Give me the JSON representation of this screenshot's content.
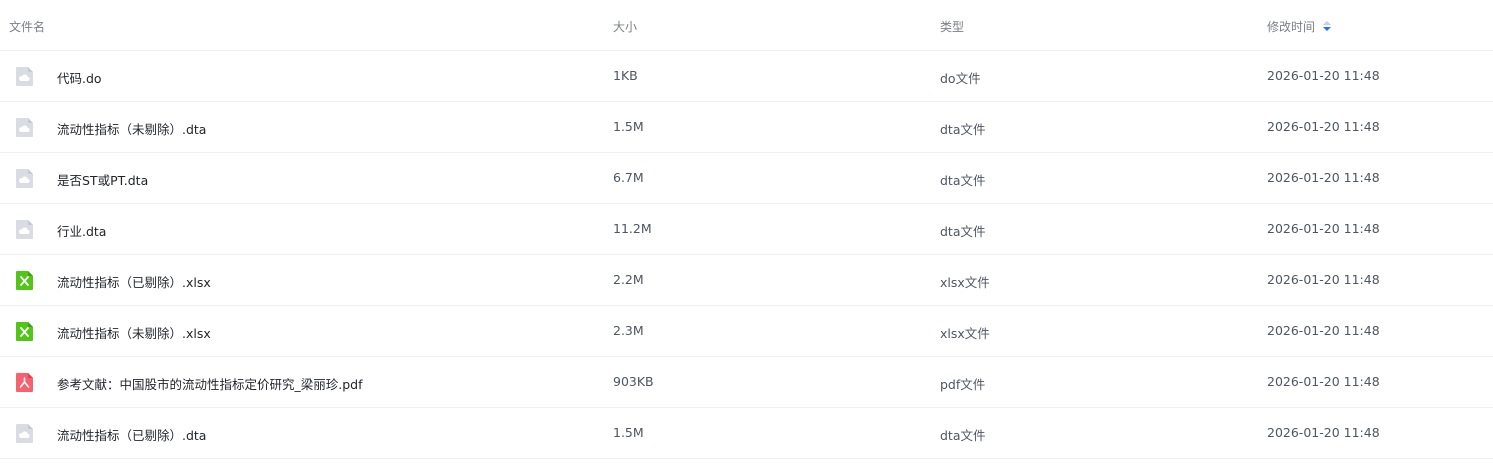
{
  "header": {
    "name": "文件名",
    "size": "大小",
    "type": "类型",
    "modified": "修改时间"
  },
  "colors": {
    "generic_icon": "#d9dde3",
    "xlsx_icon": "#52c41a",
    "pdf_icon": "#f5616f",
    "sort_active": "#1677ff"
  },
  "files": [
    {
      "name": "代码.do",
      "size": "1KB",
      "type": "do文件",
      "modified": "2026-01-20 11:48",
      "icon": "cloud-file-icon"
    },
    {
      "name": "流动性指标（未剔除）.dta",
      "size": "1.5M",
      "type": "dta文件",
      "modified": "2026-01-20 11:48",
      "icon": "cloud-file-icon"
    },
    {
      "name": "是否ST或PT.dta",
      "size": "6.7M",
      "type": "dta文件",
      "modified": "2026-01-20 11:48",
      "icon": "cloud-file-icon"
    },
    {
      "name": "行业.dta",
      "size": "11.2M",
      "type": "dta文件",
      "modified": "2026-01-20 11:48",
      "icon": "cloud-file-icon"
    },
    {
      "name": "流动性指标（已剔除）.xlsx",
      "size": "2.2M",
      "type": "xlsx文件",
      "modified": "2026-01-20 11:48",
      "icon": "excel-file-icon"
    },
    {
      "name": "流动性指标（未剔除）.xlsx",
      "size": "2.3M",
      "type": "xlsx文件",
      "modified": "2026-01-20 11:48",
      "icon": "excel-file-icon"
    },
    {
      "name": "参考文献：中国股市的流动性指标定价研究_梁丽珍.pdf",
      "size": "903KB",
      "type": "pdf文件",
      "modified": "2026-01-20 11:48",
      "icon": "pdf-file-icon"
    },
    {
      "name": "流动性指标（已剔除）.dta",
      "size": "1.5M",
      "type": "dta文件",
      "modified": "2026-01-20 11:48",
      "icon": "cloud-file-icon"
    }
  ]
}
